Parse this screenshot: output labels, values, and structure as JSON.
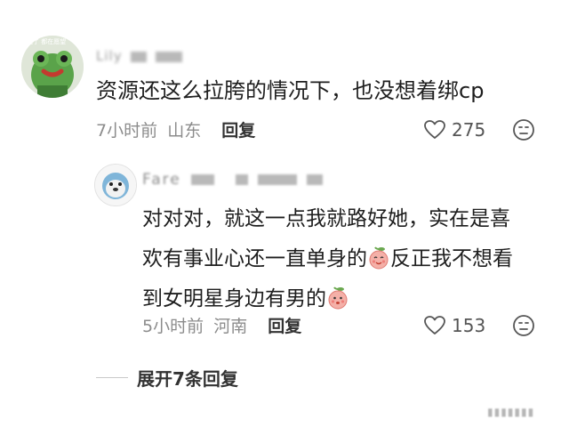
{
  "comment": {
    "username": "Lily",
    "avatar_caption": "说了 都在愿望",
    "text": "资源还这么拉胯的情况下，也没想着绑cp",
    "time": "7小时前",
    "location": "山东",
    "reply_label": "回复",
    "like_count": "275",
    "icons": [
      "heart-outline-icon",
      "dislike-face-icon"
    ]
  },
  "reply": {
    "username": "Fare",
    "text_line1": "对对对，就这一点我就路好她，实在是喜",
    "text_line2a": "欢有事业心还一直单身的",
    "text_line2b": "反正我不想看",
    "text_line3": "到女明星身边有男的",
    "emojis": [
      "peach-face-emoji",
      "peach-face-emoji"
    ],
    "time": "5小时前",
    "location": "河南",
    "reply_label": "回复",
    "like_count": "153"
  },
  "expand": {
    "label": "展开7条回复"
  },
  "colors": {
    "text": "#1e1e1e",
    "meta": "#8c8c8c",
    "accent_peach": "#f2a3a0"
  }
}
